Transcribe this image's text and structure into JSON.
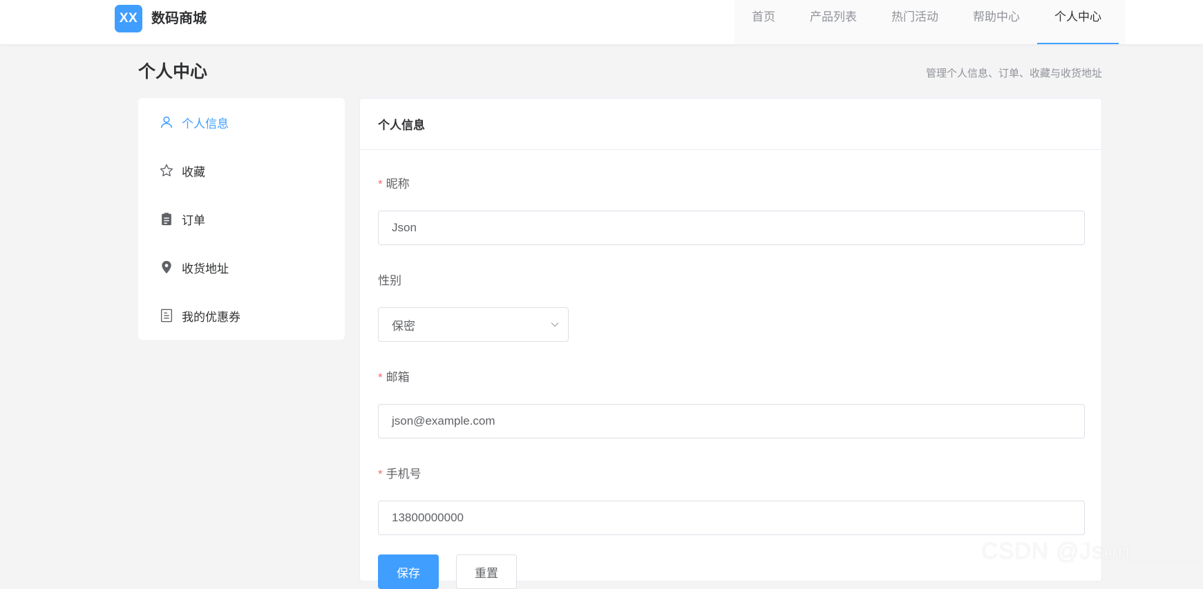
{
  "brand": {
    "logo_text": "XX",
    "name": "数码商城"
  },
  "nav": {
    "items": [
      {
        "label": "首页"
      },
      {
        "label": "产品列表"
      },
      {
        "label": "热门活动"
      },
      {
        "label": "帮助中心"
      },
      {
        "label": "个人中心",
        "active": true
      }
    ]
  },
  "page": {
    "title": "个人中心",
    "subtitle": "管理个人信息、订单、收藏与收货地址"
  },
  "sidebar": {
    "items": [
      {
        "label": "个人信息",
        "icon": "user-icon",
        "active": true
      },
      {
        "label": "收藏",
        "icon": "star-icon"
      },
      {
        "label": "订单",
        "icon": "clipboard-icon"
      },
      {
        "label": "收货地址",
        "icon": "location-icon"
      },
      {
        "label": "我的优惠券",
        "icon": "coupon-icon"
      }
    ]
  },
  "card": {
    "title": "个人信息"
  },
  "form": {
    "nickname": {
      "label": "昵称",
      "value": "Json",
      "required": true
    },
    "gender": {
      "label": "性别",
      "value": "保密",
      "required": false
    },
    "email": {
      "label": "邮箱",
      "value": "json@example.com",
      "required": true
    },
    "phone": {
      "label": "手机号",
      "value": "13800000000",
      "required": true
    },
    "save_label": "保存",
    "reset_label": "重置"
  },
  "watermark": "CSDN @Json_____",
  "colors": {
    "accent": "#409eff",
    "required": "#f56c6c",
    "background": "#f4f4f5"
  }
}
